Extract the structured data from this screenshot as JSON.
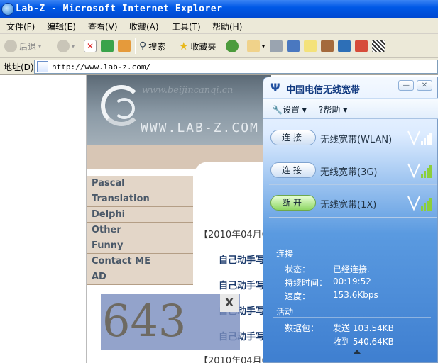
{
  "window": {
    "title": "Lab-Z - Microsoft Internet Explorer"
  },
  "menu": [
    "文件(F)",
    "编辑(E)",
    "查看(V)",
    "收藏(A)",
    "工具(T)",
    "帮助(H)"
  ],
  "toolbar": {
    "back": "后退",
    "search": "搜索",
    "favorites": "收藏夹"
  },
  "address": {
    "label": "地址(D)",
    "url": "http://www.lab-z.com/"
  },
  "site": {
    "banner_url": "www.beijincanqi.cn",
    "name": "WWW.LAB-Z.COM",
    "nav": [
      "Pascal",
      "Translation",
      "Delphi",
      "Other",
      "Funny",
      "Contact ME",
      "AD"
    ],
    "date_heading": "【2010年04月0",
    "date_heading2": "【2010年04月0",
    "posts": [
      "自己动手写",
      "自己动手写",
      "自己动手写",
      "自己动手写"
    ],
    "counter": "643",
    "counter_close": "X"
  },
  "client": {
    "title": "中国电信无线宽带",
    "menu": {
      "settings": "设置",
      "help": "帮助"
    },
    "networks": [
      {
        "button": "连接",
        "name": "无线宽带(WLAN)",
        "state": "disconnected",
        "bars": 5,
        "color": "#ffffff"
      },
      {
        "button": "连接",
        "name": "无线宽带(3G)",
        "state": "disconnected",
        "bars": 5,
        "color": "#8ccf3c"
      },
      {
        "button": "断开",
        "name": "无线宽带(1X)",
        "state": "connected",
        "bars": 5,
        "color": "#8ccf3c"
      }
    ],
    "connection": {
      "heading": "连接",
      "status_label": "状态：",
      "status_value": "已经连接.",
      "duration_label": "持续时间：",
      "duration_value": "00:19:52",
      "speed_label": "速度：",
      "speed_value": "153.6Kbps"
    },
    "activity": {
      "heading": "活动",
      "packets_label": "数据包：",
      "sent": "发送 103.54KB",
      "received": "收到 540.64KB"
    }
  }
}
